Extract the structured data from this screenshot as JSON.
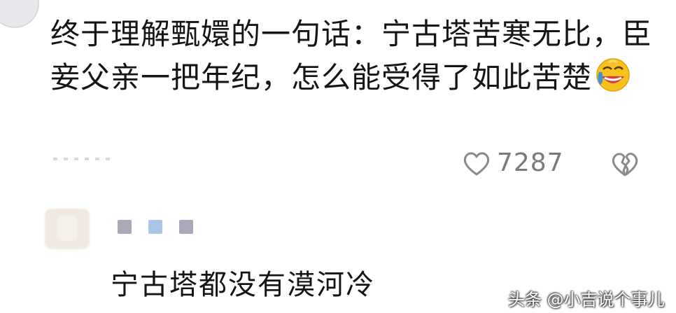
{
  "comment": {
    "text": "终于理解甄嬛的一句话：宁古塔苦寒无比，臣妾父亲一把年纪，怎么能受得了如此苦楚",
    "emoji": "laughing-tears-icon",
    "likes": "7287"
  },
  "reply": {
    "text": "宁古塔都没有漠河冷",
    "badge_colors": [
      "#a9a9b7",
      "#a8c6e8",
      "#a9a9bb"
    ]
  },
  "watermark": "头条 @小吉说个事儿",
  "colors": {
    "text": "#151515",
    "icon_gray": "#8a8a8a",
    "emoji_yellow": "#f8c21c",
    "emoji_tear": "#3d8fe0"
  }
}
